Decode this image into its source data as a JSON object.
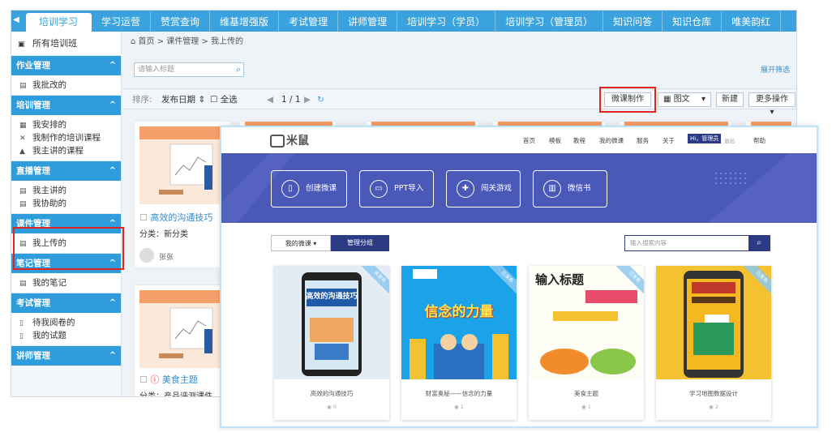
{
  "back_window": {
    "nav": [
      "培训学习",
      "学习运营",
      "赞赏查询",
      "维基增强版",
      "考试管理",
      "讲师管理",
      "培训学习（学员）",
      "培训学习（管理员）",
      "知识问答",
      "知识仓库",
      "唯美韵红"
    ],
    "sidebar": {
      "all_classes": "所有培训班",
      "sections": [
        {
          "title": "作业管理",
          "items": [
            "我批改的"
          ]
        },
        {
          "title": "培训管理",
          "items": [
            "我安排的",
            "我制作的培训课程",
            "我主讲的课程"
          ]
        },
        {
          "title": "直播管理",
          "items": [
            "我主讲的",
            "我协助的"
          ]
        },
        {
          "title": "课件管理",
          "items": [
            "我上传的"
          ]
        },
        {
          "title": "笔记管理",
          "items": [
            "我的笔记"
          ]
        },
        {
          "title": "考试管理",
          "items": [
            "待我阅卷的",
            "我的试题"
          ]
        },
        {
          "title": "讲师管理",
          "items": []
        }
      ]
    },
    "breadcrumb": [
      "首页",
      "课件管理",
      "我上传的"
    ],
    "search_placeholder": "请输入标题",
    "expand_filter": "展开筛选",
    "toolbar": {
      "sort_label": "排序:",
      "sort_field": "发布日期",
      "select_all": "全选",
      "page": "1 / 1",
      "micro_course": "微课制作",
      "view_mode": "图文",
      "new": "新建",
      "more": "更多操作"
    },
    "courses": [
      {
        "title": "高效的沟通技巧",
        "category": "分类：新分类",
        "author": "张张"
      },
      {
        "title": "美食主题",
        "category": "分类：产品评测课件"
      }
    ]
  },
  "front_window": {
    "logo": "米鼠",
    "nav": [
      "首页",
      "模板",
      "教程",
      "我的微课",
      "服务",
      "关于"
    ],
    "user_badge": "Hi，管理员",
    "logout": "退出",
    "help": "帮助",
    "banner_buttons": [
      "创建微课",
      "PPT导入",
      "闯关游戏",
      "微信书"
    ],
    "tabs": {
      "my_courses": "我的微课",
      "manage": "管理分组"
    },
    "search_placeholder": "输入搜索内容",
    "templates": [
      {
        "name": "高效的沟通技巧",
        "views": "0",
        "ribbon": "未发布"
      },
      {
        "name": "财富奥秘——信念的力量",
        "views": "1",
        "ribbon": "已发布"
      },
      {
        "name": "美食主题",
        "views": "1",
        "ribbon": "已发布"
      },
      {
        "name": "学习地图数据设计",
        "views": "2",
        "ribbon": "已发布"
      }
    ]
  },
  "colors": {
    "primary": "#3aa3dd",
    "banner": "#4a58b8",
    "dark": "#2d3a86",
    "red": "#e0241f"
  }
}
